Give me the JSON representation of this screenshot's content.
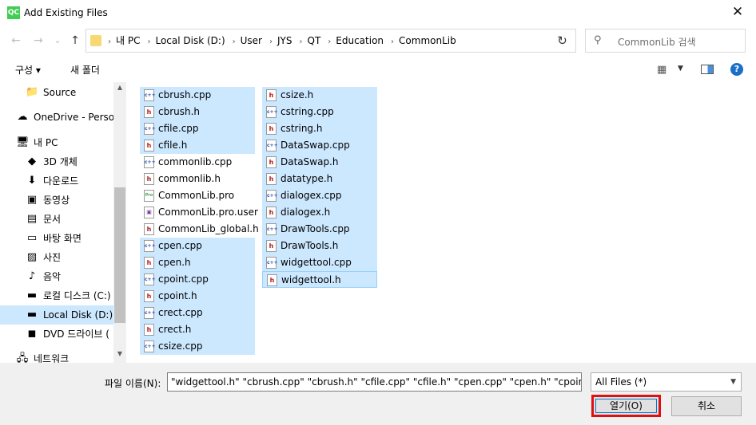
{
  "window": {
    "app_icon_text": "QC",
    "title": "Add Existing Files",
    "close_glyph": "✕"
  },
  "nav": {
    "back_glyph": "←",
    "forward_glyph": "→",
    "recent_glyph": "⌄",
    "up_glyph": "↑",
    "breadcrumbs": [
      "내 PC",
      "Local Disk (D:)",
      "User",
      "JYS",
      "QT",
      "Education",
      "CommonLib"
    ],
    "refresh_glyph": "↻",
    "search_placeholder": "CommonLib 검색",
    "search_glyph": "⚲"
  },
  "toolbar": {
    "organize_label": "구성 ▾",
    "new_folder_label": "새 폴더",
    "view_glyph": "▦",
    "view_arrow": "▼",
    "help_glyph": "?"
  },
  "sidebar": {
    "items": [
      {
        "label": "Source",
        "icon": "folder-icon",
        "glyph": "📁",
        "selected": false
      },
      {
        "label": "OneDrive - Perso",
        "icon": "cloud-icon",
        "glyph": "☁",
        "selected": false
      },
      {
        "label": "내 PC",
        "icon": "pc-icon",
        "glyph": "🖥",
        "selected": false
      },
      {
        "label": "3D 개체",
        "icon": "cube-icon",
        "glyph": "◆",
        "selected": false
      },
      {
        "label": "다운로드",
        "icon": "download-icon",
        "glyph": "⬇",
        "selected": false
      },
      {
        "label": "동영상",
        "icon": "video-icon",
        "glyph": "▣",
        "selected": false
      },
      {
        "label": "문서",
        "icon": "document-icon",
        "glyph": "▤",
        "selected": false
      },
      {
        "label": "바탕 화면",
        "icon": "desktop-icon",
        "glyph": "▭",
        "selected": false
      },
      {
        "label": "사진",
        "icon": "pictures-icon",
        "glyph": "▨",
        "selected": false
      },
      {
        "label": "음악",
        "icon": "music-icon",
        "glyph": "♪",
        "selected": false
      },
      {
        "label": "로컬 디스크 (C:)",
        "icon": "drive-icon",
        "glyph": "▬",
        "selected": false
      },
      {
        "label": "Local Disk (D:)",
        "icon": "drive-icon",
        "glyph": "▬",
        "selected": true
      },
      {
        "label": "DVD 드라이브 (",
        "icon": "dvd-icon",
        "glyph": "◼",
        "selected": false
      },
      {
        "label": "네트워크",
        "icon": "network-icon",
        "glyph": "🖧",
        "selected": false
      }
    ],
    "scroll_up_glyph": "▲",
    "scroll_down_glyph": "▼"
  },
  "files": {
    "column1": [
      {
        "name": "cbrush.cpp",
        "type": "cpp",
        "selected": true
      },
      {
        "name": "cbrush.h",
        "type": "h",
        "selected": true
      },
      {
        "name": "cfile.cpp",
        "type": "cpp",
        "selected": true
      },
      {
        "name": "cfile.h",
        "type": "h",
        "selected": true
      },
      {
        "name": "commonlib.cpp",
        "type": "cpp",
        "selected": false
      },
      {
        "name": "commonlib.h",
        "type": "h",
        "selected": false
      },
      {
        "name": "CommonLib.pro",
        "type": "pro",
        "selected": false
      },
      {
        "name": "CommonLib.pro.user",
        "type": "user",
        "selected": false
      },
      {
        "name": "CommonLib_global.h",
        "type": "h",
        "selected": false
      },
      {
        "name": "cpen.cpp",
        "type": "cpp",
        "selected": true
      },
      {
        "name": "cpen.h",
        "type": "h",
        "selected": true
      },
      {
        "name": "cpoint.cpp",
        "type": "cpp",
        "selected": true
      },
      {
        "name": "cpoint.h",
        "type": "h",
        "selected": true
      },
      {
        "name": "crect.cpp",
        "type": "cpp",
        "selected": true
      },
      {
        "name": "crect.h",
        "type": "h",
        "selected": true
      },
      {
        "name": "csize.cpp",
        "type": "cpp",
        "selected": true
      }
    ],
    "column2": [
      {
        "name": "csize.h",
        "type": "h",
        "selected": true
      },
      {
        "name": "cstring.cpp",
        "type": "cpp",
        "selected": true
      },
      {
        "name": "cstring.h",
        "type": "h",
        "selected": true
      },
      {
        "name": "DataSwap.cpp",
        "type": "cpp",
        "selected": true
      },
      {
        "name": "DataSwap.h",
        "type": "h",
        "selected": true
      },
      {
        "name": "datatype.h",
        "type": "h",
        "selected": true
      },
      {
        "name": "dialogex.cpp",
        "type": "cpp",
        "selected": true
      },
      {
        "name": "dialogex.h",
        "type": "h",
        "selected": true
      },
      {
        "name": "DrawTools.cpp",
        "type": "cpp",
        "selected": true
      },
      {
        "name": "DrawTools.h",
        "type": "h",
        "selected": true
      },
      {
        "name": "widgettool.cpp",
        "type": "cpp",
        "selected": true
      },
      {
        "name": "widgettool.h",
        "type": "h",
        "selected": true,
        "focused": true
      }
    ]
  },
  "bottom": {
    "filename_label": "파일 이름(N):",
    "filename_value": "\"widgettool.h\" \"cbrush.cpp\" \"cbrush.h\" \"cfile.cpp\" \"cfile.h\" \"cpen.cpp\" \"cpen.h\" \"cpoint.cpp\"",
    "filter_value": "All Files (*)",
    "filter_arrow": "▼",
    "open_label": "열기(O)",
    "cancel_label": "취소"
  },
  "colors": {
    "selection": "#cce8ff",
    "highlight_border": "#e01010",
    "accent": "#0078d7"
  }
}
